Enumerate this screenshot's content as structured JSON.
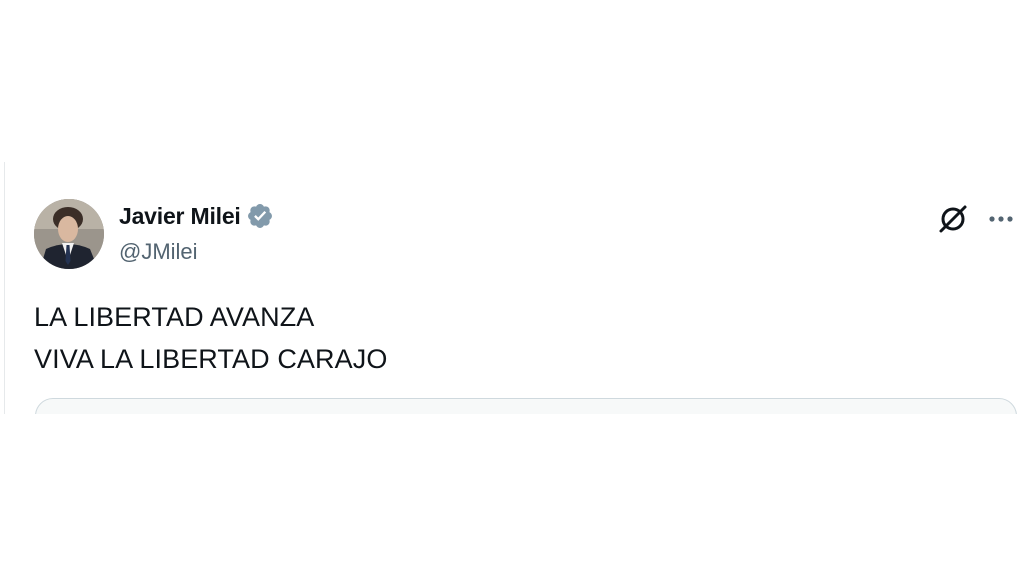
{
  "tweet": {
    "author": {
      "display_name": "Javier Milei",
      "handle": "@JMilei",
      "verified": true,
      "verified_color": "#829aab"
    },
    "text_lines": [
      "LA LIBERTAD AVANZA",
      "VIVA LA LIBERTAD CARAJO"
    ],
    "icons": {
      "grok": "grok-icon",
      "more": "more-horizontal-icon"
    }
  }
}
